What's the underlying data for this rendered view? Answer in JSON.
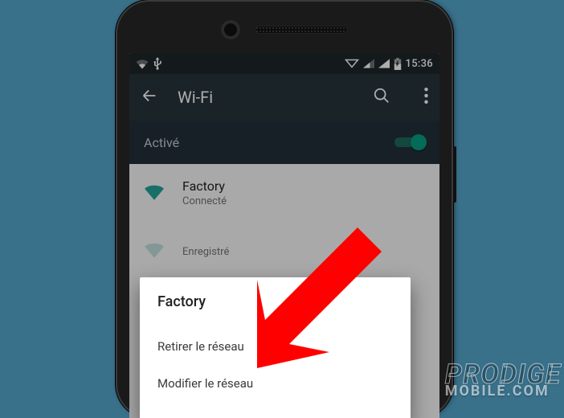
{
  "statusbar": {
    "time": "15:36"
  },
  "appbar": {
    "title": "Wi-Fi"
  },
  "enable": {
    "label": "Activé",
    "on": true
  },
  "networks": [
    {
      "name": "Factory",
      "sub": "Connecté",
      "strength": "strong"
    },
    {
      "name": "",
      "sub": "Enregistré",
      "strength": "weak"
    },
    {
      "name": "",
      "sub": "",
      "strength": "weak"
    }
  ],
  "dialog": {
    "title": "Factory",
    "items": [
      "Retirer le réseau",
      "Modifier le réseau"
    ]
  },
  "watermark": {
    "line1": "PRODIGE",
    "line2": "MOBILE.COM"
  }
}
